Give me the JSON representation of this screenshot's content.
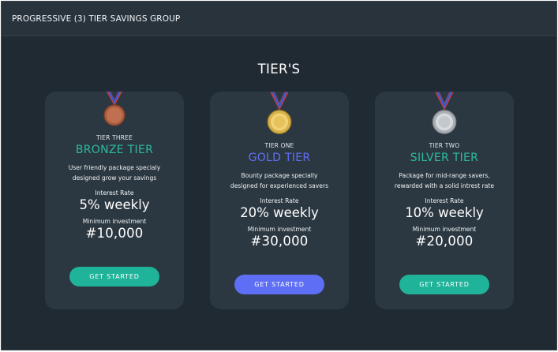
{
  "header": {
    "title": "PROGRESSIVE (3) TIER SAVINGS GROUP"
  },
  "section": {
    "title": "TIER'S"
  },
  "tiers": [
    {
      "code": "TIER THREE",
      "name": "BRONZE TIER",
      "description_line1": "User friendly package specialy",
      "description_line2": "designed grow your savings",
      "rate_label": "Interest Rate",
      "rate": "5% weekly",
      "min_label": "Minimum investment",
      "min_amount": "#10,000",
      "button": "GET STARTED",
      "medal": "bronze-medal-icon",
      "accent": "#2bbaa0"
    },
    {
      "code": "TIER ONE",
      "name": "GOLD TIER",
      "description_line1": "Bounty package specially",
      "description_line2": "designed for experienced savers",
      "rate_label": "Interest Rate",
      "rate": "20% weekly",
      "min_label": "Minimum investment",
      "min_amount": "#30,000",
      "button": "GET STARTED",
      "medal": "gold-medal-icon",
      "accent": "#5f6ff5"
    },
    {
      "code": "TIER TWO",
      "name": "SILVER TIER",
      "description_line1": "Package for mid-range savers,",
      "description_line2": "rewarded with a solid intrest rate",
      "rate_label": "Interest Rate",
      "rate": "10% weekly",
      "min_label": "Minimum investment",
      "min_amount": "#20,000",
      "button": "GET STARTED",
      "medal": "silver-medal-icon",
      "accent": "#2bbaa0"
    }
  ],
  "colors": {
    "background": "#202a33",
    "card": "#2c3841",
    "teal": "#1fb39a",
    "indigo": "#5f6ff5"
  }
}
